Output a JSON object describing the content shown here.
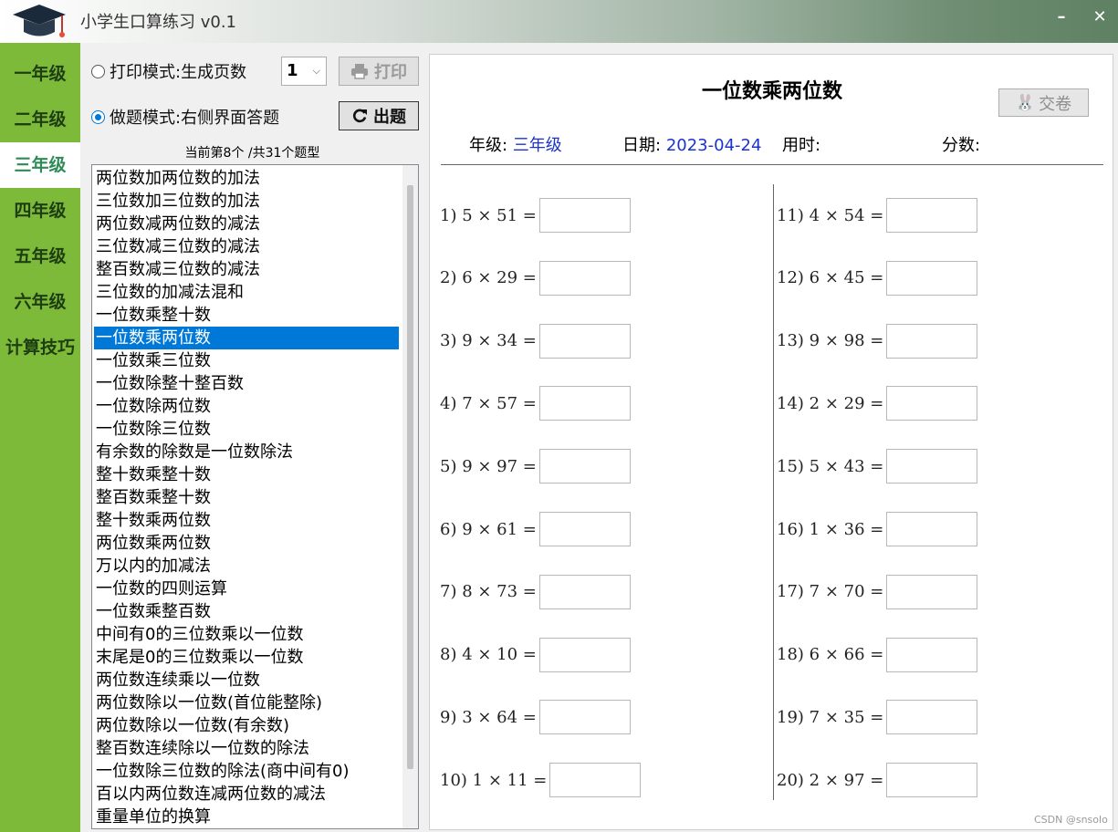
{
  "app": {
    "title": "小学生口算练习 v0.1",
    "minimize": "–",
    "close": "✕",
    "icon": "graduation-cap-icon"
  },
  "grades": [
    "一年级",
    "二年级",
    "三年级",
    "四年级",
    "五年级",
    "六年级",
    "计算技巧"
  ],
  "selected_grade": "三年级",
  "controls": {
    "print_mode_label": "打印模式:生成页数",
    "pages_value": "1",
    "print_button": "打印",
    "quiz_mode_label": "做题模式:右侧界面答题",
    "generate_button": "出题",
    "counter": "当前第8个 /共31个题型"
  },
  "topics": [
    "两位数加两位数的加法",
    "三位数加三位数的加法",
    "两位数减两位数的减法",
    "三位数减三位数的减法",
    "整百数减三位数的减法",
    "三位数的加减法混和",
    "一位数乘整十数",
    "一位数乘两位数",
    "一位数乘三位数",
    "一位数除整十整百数",
    "一位数除两位数",
    "一位数除三位数",
    "有余数的除数是一位数除法",
    "整十数乘整十数",
    "整百数乘整十数",
    "整十数乘两位数",
    "两位数乘两位数",
    "万以内的加减法",
    "一位数的四则运算",
    "一位数乘整百数",
    "中间有0的三位数乘以一位数",
    "末尾是0的三位数乘以一位数",
    "两位数连续乘以一位数",
    "两位数除以一位数(首位能整除)",
    "两位数除以一位数(有余数)",
    "整百数连续除以一位数的除法",
    "一位数除三位数的除法(商中间有0)",
    "百以内两位数连减两位数的减法",
    "重量单位的换算"
  ],
  "selected_topic": "一位数乘两位数",
  "sheet": {
    "title": "一位数乘两位数",
    "submit_button": "交卷",
    "grade_label": "年级:",
    "grade_value": "三年级",
    "date_label": "日期:",
    "date_value": "2023-04-24",
    "time_label": "用时:",
    "score_label": "分数:"
  },
  "questions": [
    "1) 5 × 51 =",
    "2) 6 × 29 =",
    "3) 9 × 34 =",
    "4) 7 × 57 =",
    "5) 9 × 97 =",
    "6) 9 × 61 =",
    "7) 8 × 73 =",
    "8) 4 × 10 =",
    "9) 3 × 64 =",
    "10) 1 × 11 =",
    "11) 4 × 54 =",
    "12) 6 × 45 =",
    "13) 9 × 98 =",
    "14) 2 × 29 =",
    "15) 5 × 43 =",
    "16) 1 × 36 =",
    "17) 7 × 70 =",
    "18) 6 × 66 =",
    "19) 7 × 35 =",
    "20) 2 × 97 ="
  ],
  "watermark": "CSDN @snsolo",
  "colors": {
    "sidebar": "#7dba39",
    "selection": "#0078d7",
    "meta_value": "#1a33cc",
    "active_grade_text": "#2e8b57"
  }
}
